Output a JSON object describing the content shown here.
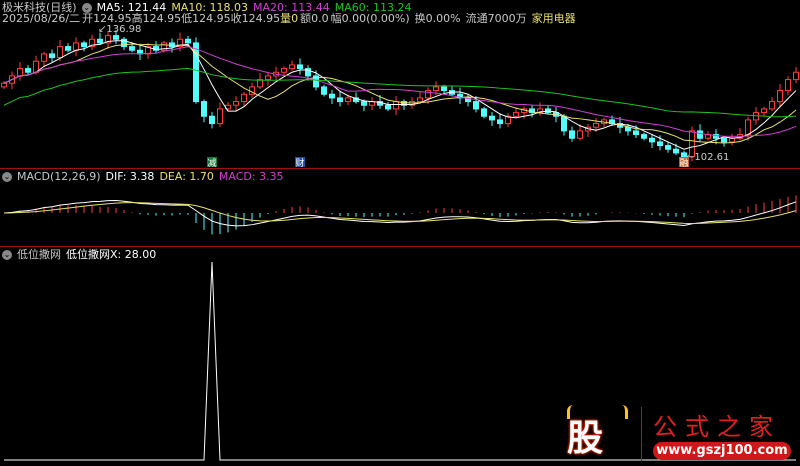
{
  "header": {
    "title": "极米科技(日线)",
    "ma5": "MA5: 121.44",
    "ma10": "MA10: 118.03",
    "ma20": "MA20: 113.44",
    "ma60": "MA60: 113.24",
    "date": "2025/08/26/二",
    "open": "开124.95",
    "high": "高124.95",
    "low": "低124.95",
    "close": "收124.95",
    "vol": "量0",
    "amount": "额0.0",
    "change": "幅0.00(0.00%)",
    "turnover": "换0.00%",
    "float": "流通7000万",
    "industry": "家用电器"
  },
  "macd_header": {
    "title": "MACD(12,26,9)",
    "dif": "DIF: 3.38",
    "dea": "DEA: 1.70",
    "macd": "MACD: 3.35"
  },
  "ind_header": {
    "name": "低位撒网",
    "value": "低位撒网X: 28.00"
  },
  "markers": {
    "max": "136.98",
    "min": "102.61",
    "m1": "减",
    "m2": "财",
    "m3": "融"
  },
  "logo": {
    "text": "股",
    "site_name": "公式之家",
    "url": "www.gszj100.com"
  },
  "colors": {
    "up": "#ff3c3c",
    "down": "#54fcfc",
    "ma5": "#ffffff",
    "ma10": "#e8e070",
    "ma20": "#d040d0",
    "ma60": "#20c020",
    "divider": "#a01010"
  },
  "chart_data": [
    {
      "type": "candlestick",
      "name": "price",
      "closes": [
        123,
        125,
        127,
        126,
        129,
        131,
        130,
        133,
        132,
        134,
        133,
        135,
        134,
        136,
        135,
        133,
        132,
        131,
        133,
        132,
        134,
        133,
        135,
        134,
        118,
        114,
        112,
        116,
        117,
        118,
        120,
        122,
        124,
        125,
        126,
        127,
        128,
        127,
        125,
        122,
        120,
        119,
        118,
        119,
        118,
        117,
        118,
        117,
        116,
        118,
        117,
        118,
        119,
        121,
        122,
        121,
        120,
        119,
        118,
        116,
        114,
        113,
        112,
        114,
        115,
        116,
        115,
        116,
        115,
        114,
        110,
        108,
        110,
        111,
        112,
        113,
        112,
        111,
        110,
        109,
        108,
        107,
        106,
        105,
        104,
        103,
        110,
        108,
        109,
        108,
        107,
        108,
        109,
        113,
        115,
        116,
        118,
        121,
        124,
        126
      ],
      "ylim": [
        102.61,
        136.98
      ],
      "ma_periods": [
        5,
        10,
        20,
        60
      ]
    },
    {
      "type": "line",
      "name": "MACD(12,26,9)",
      "params": [
        12,
        26,
        9
      ]
    },
    {
      "type": "line",
      "name": "低位撒网X",
      "points": [
        {
          "bar": 26,
          "value": 28
        }
      ],
      "baseline": 0
    }
  ]
}
